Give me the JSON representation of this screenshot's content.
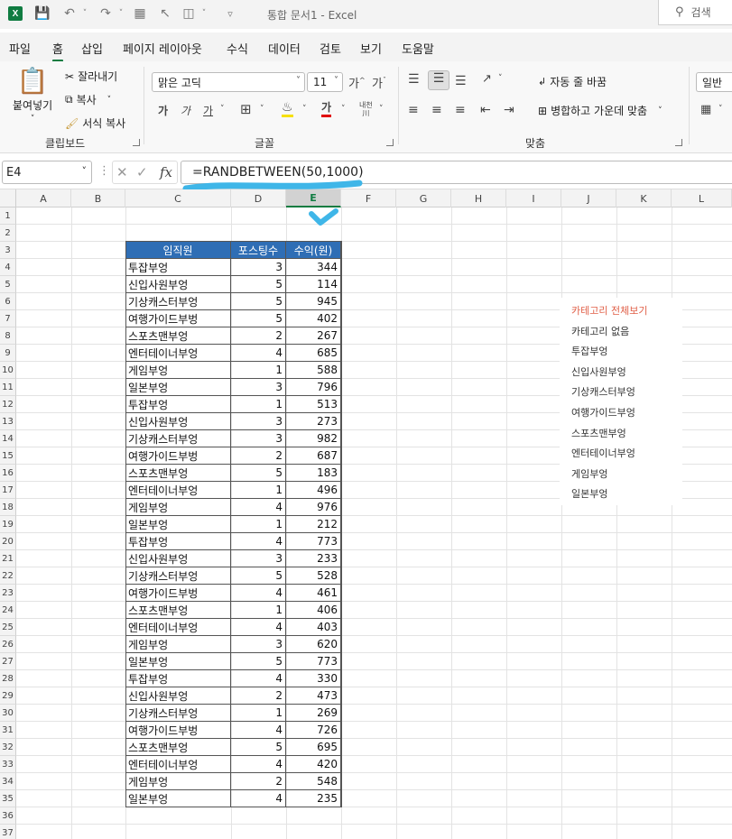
{
  "titlebar": {
    "logo": "X",
    "title": "통합 문서1  -  Excel",
    "search": "검색"
  },
  "menu": [
    "파일",
    "홈",
    "삽입",
    "페이지 레이아웃",
    "수식",
    "데이터",
    "검토",
    "보기",
    "도움말"
  ],
  "ribbon": {
    "paste": "붙여넣기",
    "cut": "잘라내기",
    "copy": "복사",
    "format_painter": "서식 복사",
    "clipboard_label": "클립보드",
    "font_name": "맑은 고딕",
    "font_size": "11",
    "font_label": "글꼴",
    "wrap_text": "자동 줄 바꿈",
    "merge_center": "병합하고 가운데 맞춤",
    "align_label": "맞춤",
    "number_format": "일반"
  },
  "formula_bar": {
    "name_box": "E4",
    "formula": "=RANDBETWEEN(50,1000)"
  },
  "columns": [
    "A",
    "B",
    "C",
    "D",
    "E",
    "F",
    "G",
    "H",
    "I",
    "J",
    "K",
    "L"
  ],
  "selected_column": "E",
  "table": {
    "headers": [
      "임직원",
      "포스팅수",
      "수익(원)"
    ],
    "rows": [
      [
        "투잡부엉",
        3,
        344
      ],
      [
        "신입사원부엉",
        5,
        114
      ],
      [
        "기상캐스터부엉",
        5,
        945
      ],
      [
        "여행가이드부벙",
        5,
        402
      ],
      [
        "스포츠맨부엉",
        2,
        267
      ],
      [
        "엔터테이너부엉",
        4,
        685
      ],
      [
        "게임부엉",
        1,
        588
      ],
      [
        "일본부엉",
        3,
        796
      ],
      [
        "투잡부엉",
        1,
        513
      ],
      [
        "신입사원부엉",
        3,
        273
      ],
      [
        "기상캐스터부엉",
        3,
        982
      ],
      [
        "여행가이드부벙",
        2,
        687
      ],
      [
        "스포츠맨부엉",
        5,
        183
      ],
      [
        "엔터테이너부엉",
        1,
        496
      ],
      [
        "게임부엉",
        4,
        976
      ],
      [
        "일본부엉",
        1,
        212
      ],
      [
        "투잡부엉",
        4,
        773
      ],
      [
        "신입사원부엉",
        3,
        233
      ],
      [
        "기상캐스터부엉",
        5,
        528
      ],
      [
        "여행가이드부벙",
        4,
        461
      ],
      [
        "스포츠맨부엉",
        1,
        406
      ],
      [
        "엔터테이너부엉",
        4,
        403
      ],
      [
        "게임부엉",
        3,
        620
      ],
      [
        "일본부엉",
        5,
        773
      ],
      [
        "투잡부엉",
        4,
        330
      ],
      [
        "신입사원부엉",
        2,
        473
      ],
      [
        "기상캐스터부엉",
        1,
        269
      ],
      [
        "여행가이드부벙",
        4,
        726
      ],
      [
        "스포츠맨부엉",
        5,
        695
      ],
      [
        "엔터테이너부엉",
        4,
        420
      ],
      [
        "게임부엉",
        2,
        548
      ],
      [
        "일본부엉",
        4,
        235
      ]
    ]
  },
  "category_list": [
    "카테고리 전체보기",
    "카테고리 없음",
    "투잡부엉",
    "신입사원부엉",
    "기상캐스터부엉",
    "여행가이드부엉",
    "스포츠맨부엉",
    "엔터테이너부엉",
    "게임부엉",
    "일본부엉"
  ],
  "colors": {
    "excel_green": "#107c41",
    "header_blue": "#2f6eb5",
    "annotation_cyan": "#3fb6e8",
    "category_accent": "#e05f47"
  }
}
